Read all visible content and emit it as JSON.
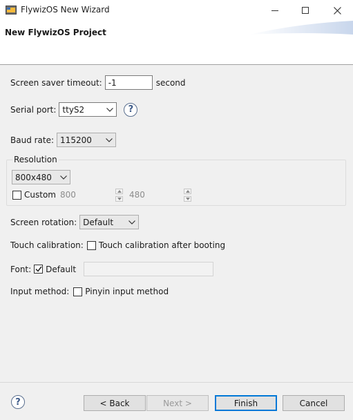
{
  "window": {
    "title": "FlywizOS New Wizard",
    "icon": "flywizos-app-icon"
  },
  "banner": {
    "title": "New FlywizOS Project"
  },
  "form": {
    "screen_saver": {
      "label": "Screen saver timeout:",
      "value": "-1",
      "unit": "second"
    },
    "serial_port": {
      "label": "Serial port:",
      "value": "ttyS2",
      "help_glyph": "?"
    },
    "baud_rate": {
      "label": "Baud rate:",
      "value": "115200"
    },
    "resolution": {
      "group_label": "Resolution",
      "value": "800x480",
      "custom_label": "Custom",
      "custom_checked": false,
      "width": "800",
      "height": "480"
    },
    "screen_rotation": {
      "label": "Screen rotation:",
      "value": "Default"
    },
    "touch_calibration": {
      "label": "Touch calibration:",
      "option_label": "Touch calibration after booting",
      "checked": false
    },
    "font": {
      "label": "Font:",
      "option_label": "Default",
      "checked": true,
      "path": ""
    },
    "input_method": {
      "label": "Input method:",
      "option_label": "Pinyin input method",
      "checked": false
    }
  },
  "footer": {
    "help_glyph": "?",
    "back_label": "< Back",
    "next_label": "Next >",
    "finish_label": "Finish",
    "cancel_label": "Cancel"
  },
  "colors": {
    "accent": "#0078d7",
    "help_icon": "#3d5a88"
  }
}
